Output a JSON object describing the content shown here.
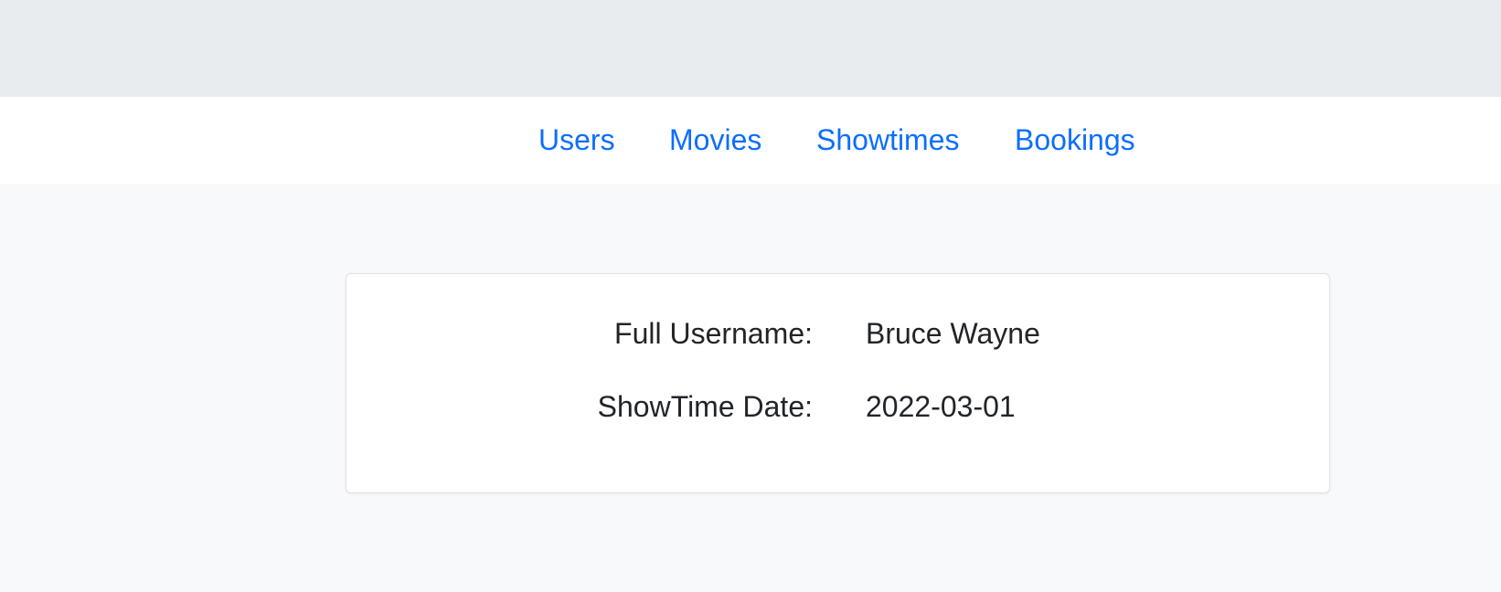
{
  "nav": {
    "items": [
      {
        "label": "Users"
      },
      {
        "label": "Movies"
      },
      {
        "label": "Showtimes"
      },
      {
        "label": "Bookings"
      }
    ]
  },
  "details": {
    "fields": [
      {
        "label": "Full Username:",
        "value": "Bruce Wayne"
      },
      {
        "label": "ShowTime Date:",
        "value": "2022-03-01"
      }
    ]
  },
  "colors": {
    "link": "#0d6efd",
    "text": "#212529",
    "page_background": "#f8f9fa",
    "top_band": "#e9ecef",
    "card_border": "#dee2e6"
  }
}
